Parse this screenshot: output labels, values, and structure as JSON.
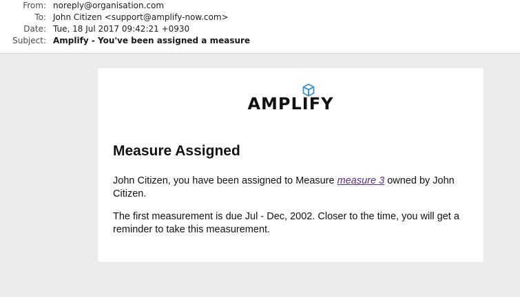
{
  "email_headers": {
    "from_label": "From:",
    "from_value": "noreply@organisation.com",
    "to_label": "To:",
    "to_value": "John Citizen <support@amplify-now.com>",
    "date_label": "Date:",
    "date_value": "Tue, 18 Jul 2017 09:42:21 +0930",
    "subject_label": "Subject:",
    "subject_value": "Amplify - You've been assigned a measure"
  },
  "email_body": {
    "logo_text": "AMPLIFY",
    "logo_icon": "cube-icon",
    "title": "Measure Assigned",
    "para1_prefix": "John Citizen, you have been assigned to Measure ",
    "para1_link": "measure 3",
    "para1_suffix": " owned by John Citizen.",
    "para2": "The first measurement is due Jul - Dec, 2002. Closer to the time, you will get a reminder to take this measurement."
  },
  "colors": {
    "background": "#ebebeb",
    "card": "#ffffff",
    "link": "#5b2a8a",
    "logo_accent": "#3a8fd0"
  }
}
